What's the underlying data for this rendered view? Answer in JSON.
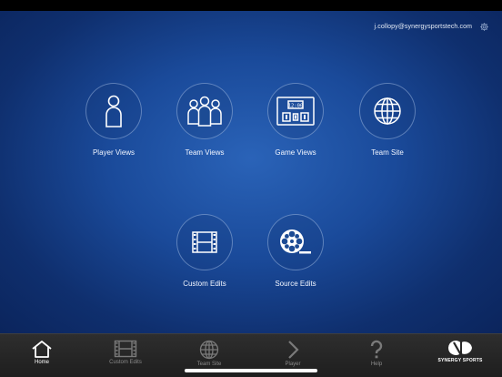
{
  "header": {
    "user_email": "j.collopy@synergysportstech.com"
  },
  "tiles": {
    "player_views": "Player Views",
    "team_views": "Team Views",
    "game_views": "Game Views",
    "team_site": "Team Site",
    "custom_edits": "Custom Edits",
    "source_edits": "Source Edits"
  },
  "scoreboard": {
    "clock": "12:00"
  },
  "tabbar": {
    "home": "Home",
    "custom_edits": "Custom Edits",
    "team_site": "Team Site",
    "player": "Player",
    "help": "Help",
    "brand": "SYNERGY SPORTS"
  },
  "icons": {
    "header": [
      "settings-gear-icon"
    ],
    "tiles": [
      "player-icon",
      "team-icon",
      "scoreboard-icon",
      "globe-icon",
      "film-strip-icon",
      "film-reel-icon"
    ],
    "tabs": [
      "home-icon",
      "film-strip-icon",
      "globe-icon",
      "chevron-right-icon",
      "question-mark-icon",
      "synergy-logo-icon"
    ]
  },
  "colors": {
    "background": "#1a4a9a",
    "tab_bar": "#262626",
    "tab_active": "#ffffff",
    "tab_inactive": "#8a8a8a",
    "icon_stroke": "#ffffff"
  },
  "active_tab": "Home"
}
